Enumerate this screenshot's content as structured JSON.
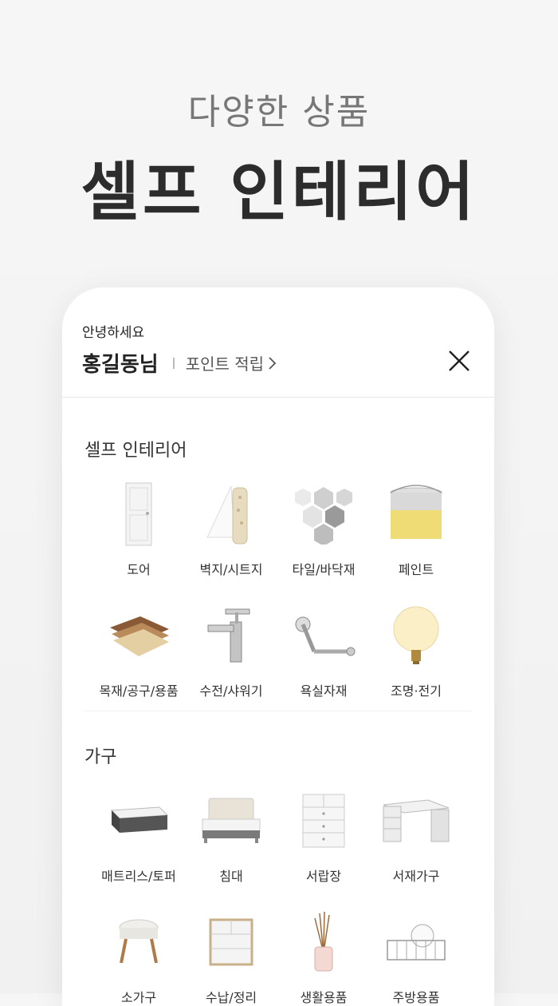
{
  "hero": {
    "subtitle": "다양한 상품",
    "title": "셀프 인테리어"
  },
  "header": {
    "greeting": "안녕하세요",
    "user_name": "홍길동님",
    "point_link": "포인트 적립"
  },
  "sections": [
    {
      "title": "셀프 인테리어",
      "items": [
        {
          "label": "도어",
          "icon": "door-icon"
        },
        {
          "label": "벽지/시트지",
          "icon": "wallpaper-roll-icon"
        },
        {
          "label": "타일/바닥재",
          "icon": "hexagon-tile-icon"
        },
        {
          "label": "페인트",
          "icon": "paint-can-icon"
        },
        {
          "label": "목재/공구/용품",
          "icon": "wood-samples-icon"
        },
        {
          "label": "수전/샤워기",
          "icon": "faucet-icon"
        },
        {
          "label": "욕실자재",
          "icon": "towel-bar-icon"
        },
        {
          "label": "조명·전기",
          "icon": "light-bulb-icon"
        }
      ]
    },
    {
      "title": "가구",
      "items": [
        {
          "label": "매트리스/토퍼",
          "icon": "mattress-icon"
        },
        {
          "label": "침대",
          "icon": "bed-icon"
        },
        {
          "label": "서랍장",
          "icon": "drawer-chest-icon"
        },
        {
          "label": "서재가구",
          "icon": "desk-icon"
        },
        {
          "label": "소가구",
          "icon": "stool-icon"
        },
        {
          "label": "수납/정리",
          "icon": "storage-cabinet-icon"
        },
        {
          "label": "생활용품",
          "icon": "diffuser-icon"
        },
        {
          "label": "주방용품",
          "icon": "dish-rack-icon"
        }
      ]
    }
  ]
}
